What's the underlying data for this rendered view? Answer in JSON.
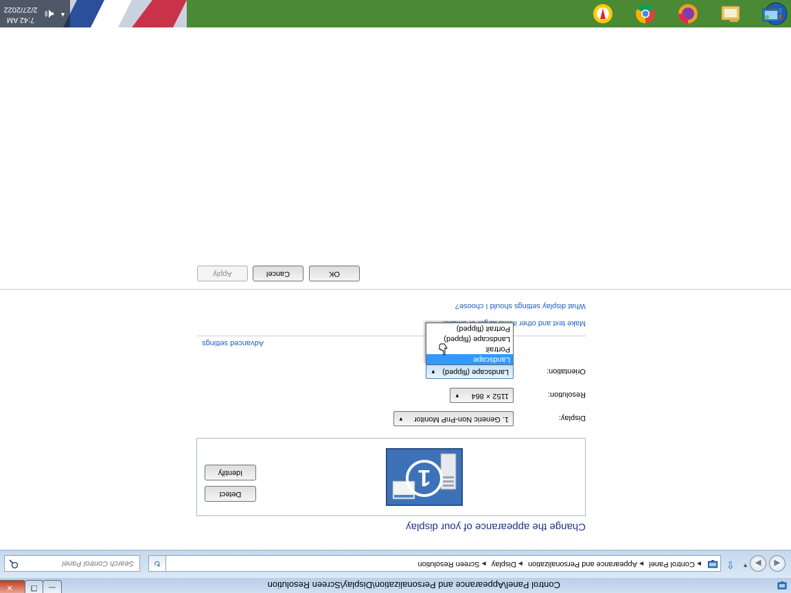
{
  "window": {
    "title": "Control Panel\\Appearance and Personalization\\Display\\Screen Resolution",
    "min_glyph": "—",
    "max_glyph": "❐",
    "close_glyph": "✕"
  },
  "nav": {
    "back_glyph": "◀",
    "forward_glyph": "▶",
    "recent_glyph": "▼",
    "up_glyph": "⇧",
    "refresh_glyph": "↻",
    "breadcrumbs": [
      "Control Panel",
      "Appearance and Personalization",
      "Display",
      "Screen Resolution"
    ],
    "breadcrumb_sep": "▶",
    "address_drop": "▼",
    "search_placeholder": "Search Control Panel"
  },
  "content": {
    "heading": "Change the appearance of your display",
    "detect_label": "Detect",
    "identify_label": "Identify",
    "monitor_number": "1",
    "display_label": "Display:",
    "display_value": "1. Generic Non-PnP Monitor",
    "resolution_label": "Resolution:",
    "resolution_value": "1152 × 864",
    "orientation_label": "Orientation:",
    "orientation_value": "Landscape (flipped)",
    "dropdown_arrow": "▼",
    "orientation_options": [
      "Landscape",
      "Portrait",
      "Landscape (flipped)",
      "Portrait (flipped)"
    ],
    "orientation_highlighted": "Landscape",
    "advanced_link": "Advanced settings",
    "textsize_link": "Make text and other items larger or smaller",
    "whatdisplay_link": "What display settings should I choose?",
    "ok_label": "OK",
    "cancel_label": "Cancel",
    "apply_label": "Apply"
  },
  "taskbar": {
    "apps": [
      "start-orb-icon",
      "explorer-icon",
      "firefox-icon",
      "chrome-icon",
      "yandex-icon",
      "control-panel-icon"
    ],
    "tray_arrow": "▲",
    "time": "7:42 AM",
    "date": "2/27/2022"
  },
  "colors": {
    "heading": "#1e3287",
    "link": "#1d5ebf",
    "highlight": "#3399ff",
    "taskbar": "#4a8a35"
  }
}
